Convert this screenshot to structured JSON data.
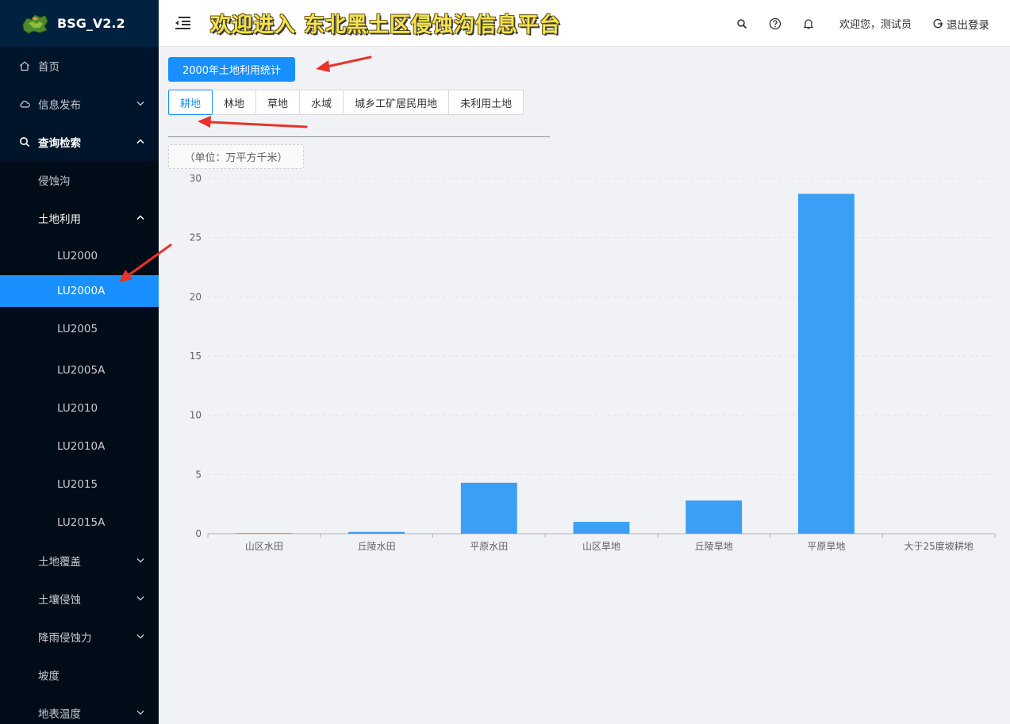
{
  "app": {
    "logo_text": "BSG_V2.2"
  },
  "header": {
    "banner": "欢迎进入 东北黑土区侵蚀沟信息平台",
    "welcome": "欢迎您，测试员",
    "logout": "退出登录"
  },
  "sidebar": {
    "items": [
      {
        "label": "首页"
      },
      {
        "label": "信息发布"
      },
      {
        "label": "查询检索"
      },
      {
        "label": "侵蚀沟"
      },
      {
        "label": "土地利用"
      },
      {
        "label": "LU2000"
      },
      {
        "label": "LU2000A"
      },
      {
        "label": "LU2005"
      },
      {
        "label": "LU2005A"
      },
      {
        "label": "LU2010"
      },
      {
        "label": "LU2010A"
      },
      {
        "label": "LU2015"
      },
      {
        "label": "LU2015A"
      },
      {
        "label": "土地覆盖"
      },
      {
        "label": "土壤侵蚀"
      },
      {
        "label": "降雨侵蚀力"
      },
      {
        "label": "坡度"
      },
      {
        "label": "地表温度"
      }
    ]
  },
  "content": {
    "stat_button": "2000年土地利用统计",
    "tabs": [
      "耕地",
      "林地",
      "草地",
      "水域",
      "城乡工矿居民用地",
      "未利用土地"
    ],
    "unit": "（单位：万平方千米）"
  },
  "chart_data": {
    "type": "bar",
    "categories": [
      "山区水田",
      "丘陵水田",
      "平原水田",
      "山区旱地",
      "丘陵旱地",
      "平原旱地",
      "大于25度坡耕地"
    ],
    "values": [
      0.05,
      0.15,
      4.3,
      1.0,
      2.8,
      28.7,
      0
    ],
    "ylim": [
      0,
      30
    ],
    "yticks": [
      0,
      5,
      10,
      15,
      20,
      25,
      30
    ],
    "bar_color": "#3a9ff5",
    "grid": true
  },
  "colors": {
    "accent": "#1890ff",
    "sidebar_bg": "#001529",
    "annotation": "#e8322b"
  }
}
